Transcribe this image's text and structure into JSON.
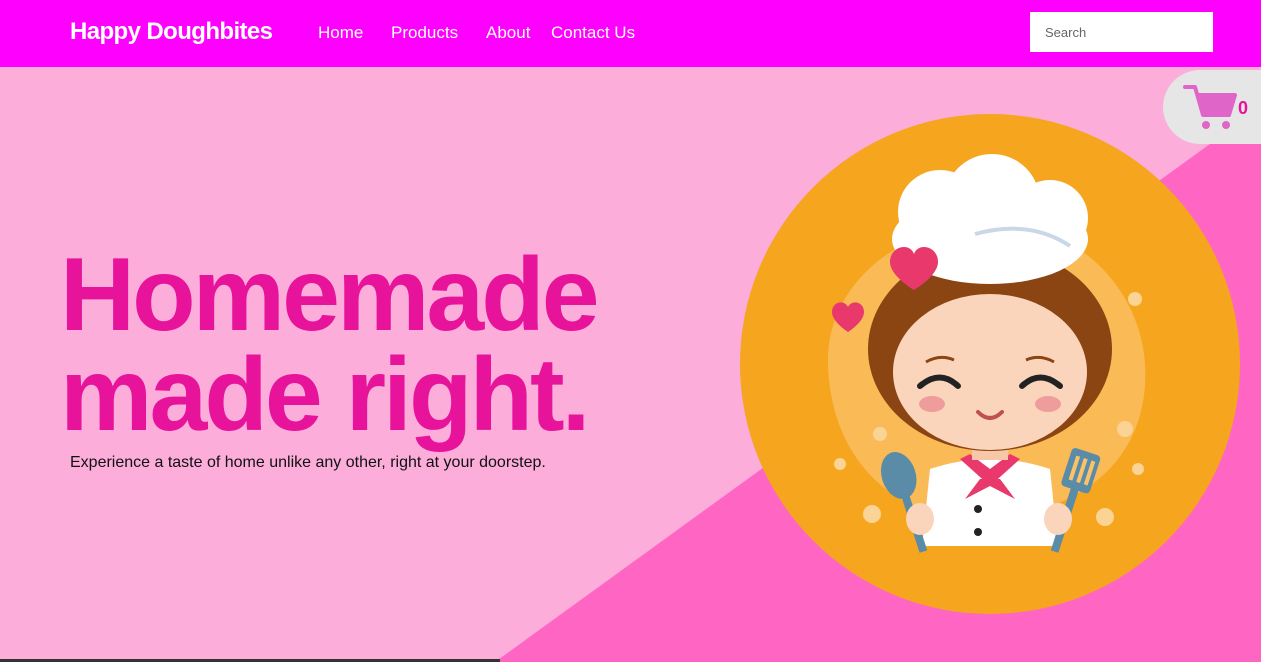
{
  "brand": "Happy Doughbites",
  "nav": {
    "items": [
      {
        "label": "Home"
      },
      {
        "label": "Products"
      },
      {
        "label": "About"
      },
      {
        "label": "Contact Us"
      }
    ]
  },
  "search": {
    "placeholder": "Search"
  },
  "hero": {
    "headline_line1": "Homemade",
    "headline_line2": "made right.",
    "tagline": "Experience a taste of home unlike any other, right at your doorstep."
  },
  "cart": {
    "count": "0"
  },
  "colors": {
    "navbar": "#fe00fe",
    "hero_bg": "#fcadda",
    "hero_diagonal": "#ff66c4",
    "headline": "#e8139b",
    "circle": "#f5a51e"
  },
  "icons": [
    "shopping-cart-icon"
  ]
}
